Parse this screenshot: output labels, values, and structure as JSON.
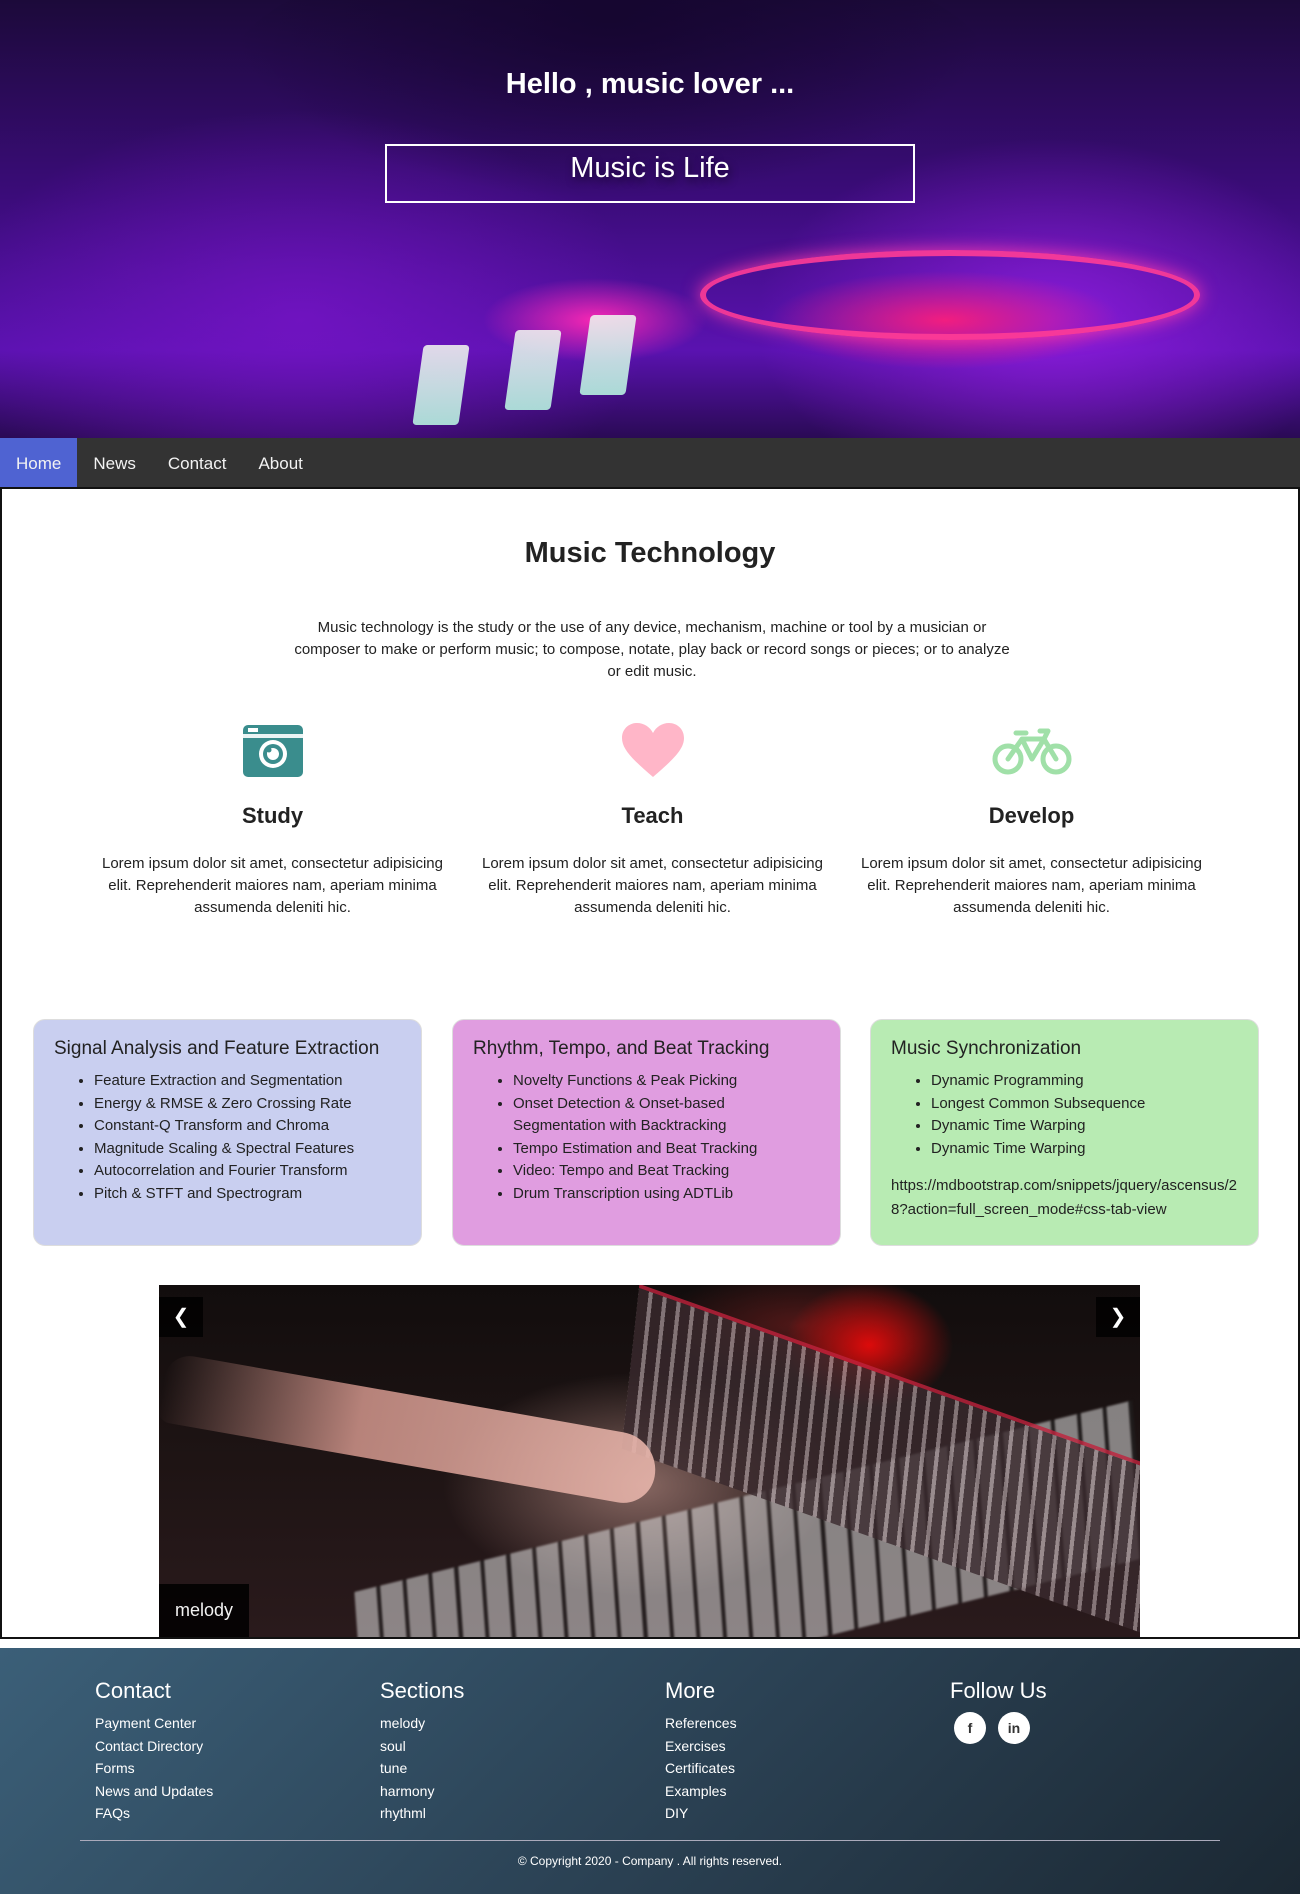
{
  "hero": {
    "title": "Hello , music lover ...",
    "tagline": "Music is Life"
  },
  "nav": {
    "items": [
      {
        "label": "Home",
        "active": true
      },
      {
        "label": "News"
      },
      {
        "label": "Contact"
      },
      {
        "label": "About"
      }
    ]
  },
  "main": {
    "title": "Music Technology",
    "intro": "Music technology is the study or the use of any device, mechanism, machine or tool by a musician or composer to make or perform music; to compose, notate, play back or record songs or pieces; or to analyze or edit music.",
    "features": [
      {
        "icon": "camera-icon",
        "color": "#3a8d8d",
        "title": "Study",
        "text": "Lorem ipsum dolor sit amet, consectetur adipisicing elit. Reprehenderit maiores nam, aperiam minima assumenda deleniti hic."
      },
      {
        "icon": "heart-icon",
        "color": "#ffb6c8",
        "title": "Teach",
        "text": "Lorem ipsum dolor sit amet, consectetur adipisicing elit. Reprehenderit maiores nam, aperiam minima assumenda deleniti hic."
      },
      {
        "icon": "bicycle-icon",
        "color": "#a0e0a8",
        "title": "Develop",
        "text": "Lorem ipsum dolor sit amet, consectetur adipisicing elit. Reprehenderit maiores nam, aperiam minima assumenda deleniti hic."
      }
    ],
    "cards": [
      {
        "title": "Signal Analysis and Feature Extraction",
        "color": "#c9cff0",
        "items": [
          "Feature Extraction and Segmentation",
          "Energy & RMSE & Zero Crossing Rate",
          "Constant-Q Transform and Chroma",
          "Magnitude Scaling & Spectral Features",
          "Autocorrelation and Fourier Transform",
          "Pitch & STFT and Spectrogram"
        ]
      },
      {
        "title": "Rhythm, Tempo, and Beat Tracking",
        "color": "#e09de0",
        "items": [
          "Novelty Functions & Peak Picking",
          "Onset Detection & Onset-based Segmentation with Backtracking",
          "Tempo Estimation and Beat Tracking",
          "Video: Tempo and Beat Tracking",
          "Drum Transcription using ADTLib"
        ]
      },
      {
        "title": "Music Synchronization",
        "color": "#b8ebb3",
        "items": [
          "Dynamic Programming",
          "Longest Common Subsequence",
          "Dynamic Time Warping",
          "Dynamic Time Warping"
        ],
        "link": "https://mdbootstrap.com/snippets/jquery/ascensus/28?action=full_screen_mode#css-tab-view"
      }
    ],
    "slider": {
      "prev": "❮",
      "next": "❯",
      "caption": "melody"
    }
  },
  "footer": {
    "columns": [
      {
        "title": "Contact",
        "links": [
          "Payment Center",
          "Contact Directory",
          "Forms",
          "News and Updates",
          "FAQs"
        ]
      },
      {
        "title": "Sections",
        "links": [
          "melody",
          "soul",
          "tune",
          "harmony",
          "rhythml"
        ]
      },
      {
        "title": "More",
        "links": [
          "References",
          "Exercises",
          "Certificates",
          "Examples",
          "DIY"
        ]
      }
    ],
    "follow": {
      "title": "Follow Us",
      "icons": [
        "facebook-icon",
        "linkedin-icon"
      ],
      "facebook_glyph": "f",
      "linkedin_glyph": "in"
    },
    "copyright": "© Copyright 2020 - Company . All rights reserved."
  }
}
